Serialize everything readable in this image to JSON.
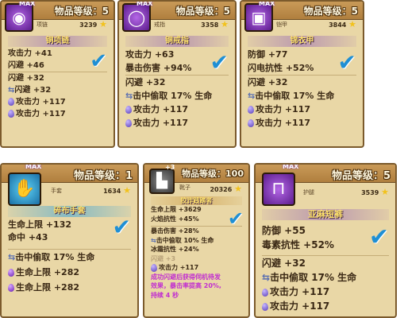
{
  "cards": [
    {
      "level_label": "物品等级：5",
      "max_label": "MAX",
      "slot": "项链",
      "score": "3239",
      "name": "铜项链",
      "rows": [
        "攻击力 +41",
        "闪避 +46",
        "闪避 +32",
        "闪避 +32",
        "攻击力 +117",
        "攻击力 +117"
      ]
    },
    {
      "level_label": "物品等级：5",
      "max_label": "MAX",
      "slot": "戒指",
      "score": "3358",
      "name": "铜戒指",
      "rows": [
        "攻击力 +63",
        "暴击伤害 +94%",
        "闪避 +32",
        "击中偷取 17% 生命",
        "攻击力 +117",
        "攻击力 +117"
      ]
    },
    {
      "level_label": "物品等级：5",
      "max_label": "MAX",
      "slot": "铠甲",
      "score": "3844",
      "name": "锦衣甲",
      "rows": [
        "防御 +77",
        "闪电抗性 +52%",
        "闪避 +32",
        "击中偷取 17% 生命",
        "攻击力 +117",
        "攻击力 +117"
      ]
    },
    {
      "level_label": "物品等级：1",
      "max_label": "MAX",
      "slot": "手套",
      "score": "1634",
      "name": "碎布手套",
      "rows": [
        "生命上限 +132",
        "命中 +43",
        "击中偷取 17% 生命",
        "生命上限 +282",
        "生命上限 +282"
      ]
    },
    {
      "level_label": "物品等级：100",
      "plus_label": "+3",
      "slot": "靴子",
      "score": "20326",
      "name": "狡诈践踏者",
      "rows": [
        "生命上限 +3629",
        "火焰抗性 +45%",
        "暴击伤害 +28%",
        "击中偷取 10% 生命",
        "冰霜抗性 +24%",
        "闪避 +3",
        "攻击力 +117",
        "成功闪避后获得伺机待发",
        "效果，暴击率提高 20%,",
        "持续 4 秒"
      ]
    },
    {
      "level_label": "物品等级：5",
      "max_label": "MAX",
      "slot": "护腿",
      "score": "3539",
      "name": "亚麻短裤",
      "rows": [
        "防御 +55",
        "毒素抗性 +52%",
        "闪避 +32",
        "击中偷取 17% 生命",
        "攻击力 +117",
        "攻击力 +117"
      ]
    }
  ]
}
